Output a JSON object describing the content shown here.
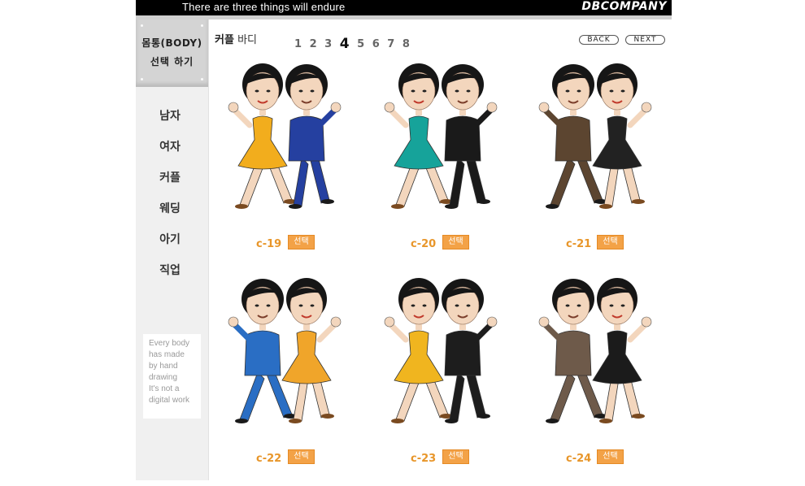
{
  "banner": {
    "slogan": "There are three things will endure",
    "brand": "DBCOMPANY"
  },
  "sidebar": {
    "card_line1": "몸통(BODY)",
    "card_line2": "선택 하기",
    "items": [
      {
        "label": "남자"
      },
      {
        "label": "여자"
      },
      {
        "label": "커플"
      },
      {
        "label": "웨딩"
      },
      {
        "label": "아기"
      },
      {
        "label": "직업"
      }
    ],
    "note": [
      "Every body",
      "has made",
      "by hand",
      "drawing",
      "It's not a",
      "digital work"
    ]
  },
  "header": {
    "breadcrumb_category": "커플",
    "breadcrumb_item": "바디",
    "pages": [
      "1",
      "2",
      "3",
      "4",
      "5",
      "6",
      "7",
      "8"
    ],
    "current_page": "4",
    "back_label": "BACK",
    "next_label": "NEXT"
  },
  "items": [
    {
      "code": "c-19",
      "select": "선택",
      "outfit_left": "#f2ad1d",
      "outfit_right": "#2540a0"
    },
    {
      "code": "c-20",
      "select": "선택",
      "outfit_left": "#16a39a",
      "outfit_right": "#1a1a1a"
    },
    {
      "code": "c-21",
      "select": "선택",
      "outfit_left": "#5c4530",
      "outfit_right": "#222222"
    },
    {
      "code": "c-22",
      "select": "선택",
      "outfit_left": "#2a6ec4",
      "outfit_right": "#f0a52a"
    },
    {
      "code": "c-23",
      "select": "선택",
      "outfit_left": "#f0b51f",
      "outfit_right": "#1d1d1d"
    },
    {
      "code": "c-24",
      "select": "선택",
      "outfit_left": "#6e5a4a",
      "outfit_right": "#1b1b1b"
    }
  ],
  "colors": {
    "accent": "#f3a247",
    "code_text": "#e8962a",
    "banner": "#000000"
  }
}
